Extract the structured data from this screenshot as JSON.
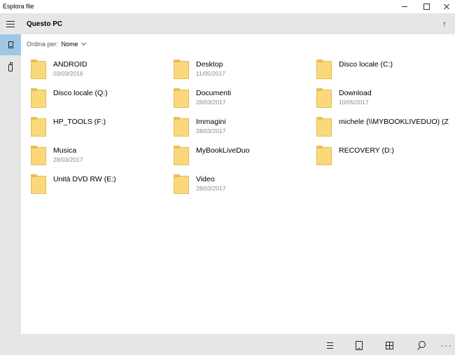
{
  "window": {
    "title": "Esplora file"
  },
  "header": {
    "title": "Questo PC",
    "up_icon": "arrow-up-icon"
  },
  "sort": {
    "label": "Ordina per:",
    "value": "Nome"
  },
  "items": [
    {
      "name": "ANDROID",
      "date": "03/03/2016"
    },
    {
      "name": "Desktop",
      "date": "11/05/2017"
    },
    {
      "name": "Disco locale (C:)",
      "date": ""
    },
    {
      "name": "Disco locale (Q:)",
      "date": ""
    },
    {
      "name": "Documenti",
      "date": "28/03/2017"
    },
    {
      "name": "Download",
      "date": "10/05/2017"
    },
    {
      "name": "HP_TOOLS (F:)",
      "date": ""
    },
    {
      "name": "Immagini",
      "date": "28/03/2017"
    },
    {
      "name": "michele (\\\\MYBOOKLIVEDUO) (Z",
      "date": ""
    },
    {
      "name": "Musica",
      "date": "28/03/2017"
    },
    {
      "name": "MyBookLiveDuo",
      "date": ""
    },
    {
      "name": "RECOVERY (D:)",
      "date": ""
    },
    {
      "name": "Unità DVD RW (E:)",
      "date": ""
    },
    {
      "name": "Video",
      "date": "28/03/2017"
    }
  ],
  "colors": {
    "rail_bg": "#e6e6e6",
    "rail_active": "#9ec7e6",
    "folder_fill": "#fbd97a",
    "folder_border": "#e3bc5a"
  },
  "bottombar": {
    "icons": [
      "list-view-icon",
      "device-icon",
      "grid-view-icon",
      "search-icon",
      "more-icon"
    ]
  }
}
